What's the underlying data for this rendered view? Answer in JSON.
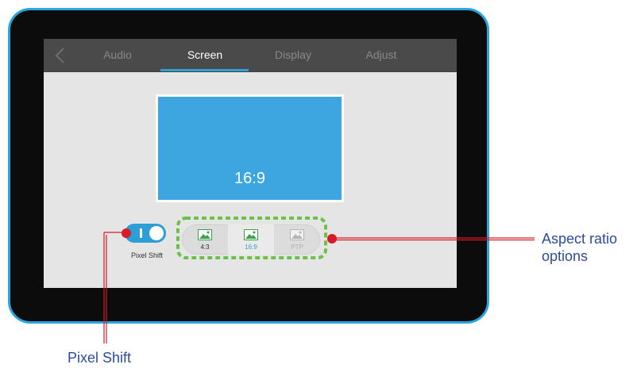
{
  "tabs": [
    {
      "label": "Audio",
      "active": false
    },
    {
      "label": "Screen",
      "active": true
    },
    {
      "label": "Display",
      "active": false
    },
    {
      "label": "Adjust",
      "active": false
    }
  ],
  "preview": {
    "ratio_label": "16:9"
  },
  "pixel_shift": {
    "label": "Pixel Shift",
    "enabled": true
  },
  "aspect_ratios": [
    {
      "label": "4:3",
      "state": "normal"
    },
    {
      "label": "16:9",
      "state": "selected"
    },
    {
      "label": "PTP",
      "state": "disabled"
    }
  ],
  "callouts": {
    "aspect_line1": "Aspect ratio",
    "aspect_line2": "options",
    "pixel_shift": "Pixel Shift"
  },
  "colors": {
    "accent": "#2e9fd6",
    "preview": "#3da6e0",
    "callout_text": "#2b4ba0",
    "highlight_dash": "#6cc04a",
    "marker": "#d7192a",
    "frame_border": "#29a6df"
  }
}
